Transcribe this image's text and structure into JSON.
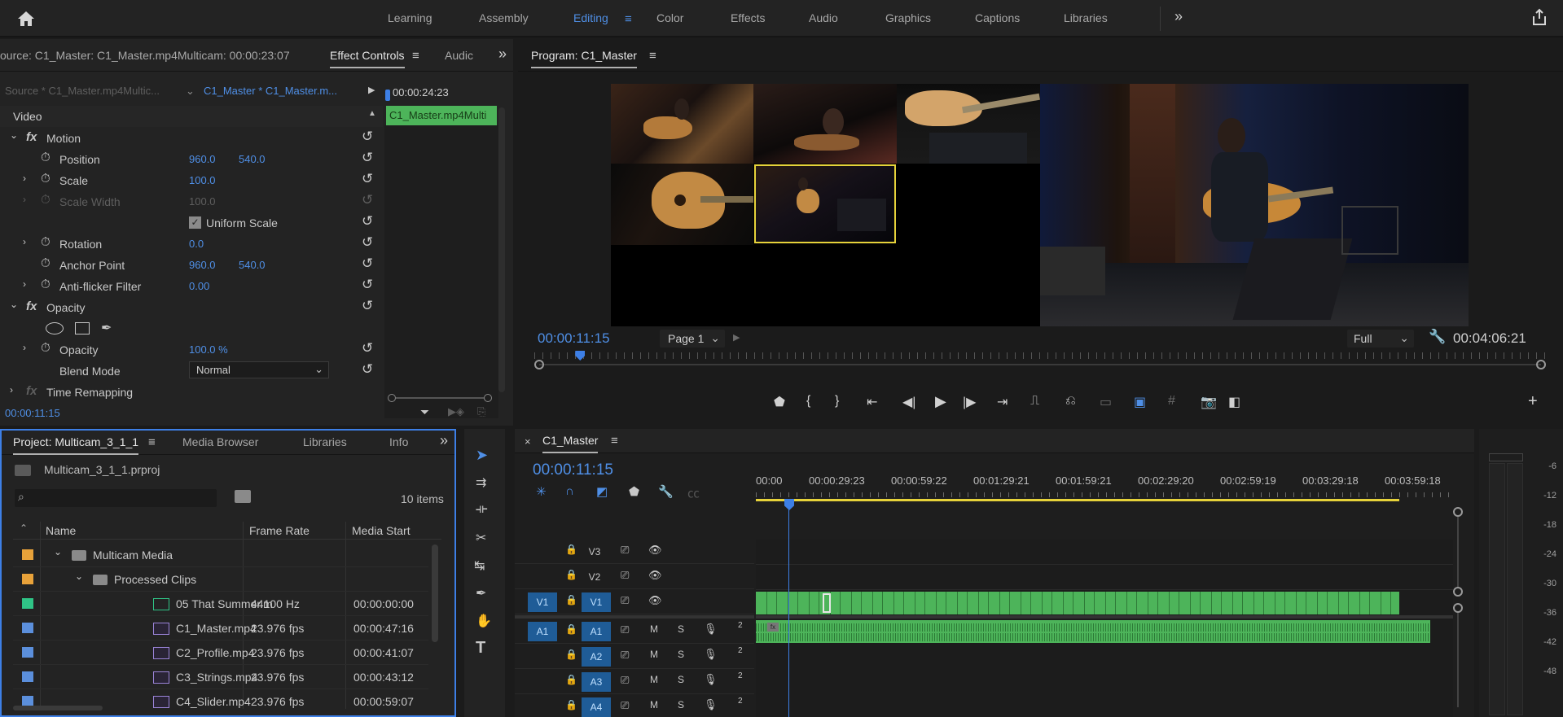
{
  "workspaces": {
    "tabs": [
      {
        "label": "Learning",
        "active": false
      },
      {
        "label": "Assembly",
        "active": false
      },
      {
        "label": "Editing",
        "active": true
      },
      {
        "label": "Color",
        "active": false
      },
      {
        "label": "Effects",
        "active": false
      },
      {
        "label": "Audio",
        "active": false
      },
      {
        "label": "Graphics",
        "active": false
      },
      {
        "label": "Captions",
        "active": false
      },
      {
        "label": "Libraries",
        "active": false
      }
    ],
    "accent": "#4f8fe6"
  },
  "effect_controls": {
    "source_tab": "ource: C1_Master: C1_Master.mp4Multicam: 00:00:23:07",
    "tab_label": "Effect Controls",
    "audio_tab": "Audic",
    "source_dropdown": "Source * C1_Master.mp4Multic...",
    "sequence_dropdown": "C1_Master * C1_Master.m...",
    "mini_timecode": "00:00:24:23",
    "clip_label": "C1_Master.mp4Multi",
    "section_video": "Video",
    "motion": "Motion",
    "position_label": "Position",
    "position_x": "960.0",
    "position_y": "540.0",
    "scale_label": "Scale",
    "scale_value": "100.0",
    "scale_width_label": "Scale Width",
    "scale_width_value": "100.0",
    "uniform_scale_label": "Uniform Scale",
    "rotation_label": "Rotation",
    "rotation_value": "0.0",
    "anchor_label": "Anchor Point",
    "anchor_x": "960.0",
    "anchor_y": "540.0",
    "antiflicker_label": "Anti-flicker Filter",
    "antiflicker_value": "0.00",
    "opacity_section": "Opacity",
    "opacity_label": "Opacity",
    "opacity_value": "100.0 %",
    "blend_label": "Blend Mode",
    "blend_value": "Normal",
    "time_remap_label": "Time Remapping",
    "timecode": "00:00:11:15"
  },
  "program": {
    "title": "Program: C1_Master",
    "timecode": "00:00:11:15",
    "page_dropdown": "Page 1",
    "quality": "Full",
    "duration": "00:04:06:21",
    "playhead_fraction": 0.036
  },
  "project": {
    "tabs": [
      "Project: Multicam_3_1_1",
      "Media Browser",
      "Libraries",
      "Info"
    ],
    "project_file": "Multicam_3_1_1.prproj",
    "items_count": "10 items",
    "search_placeholder": "",
    "columns": [
      "Name",
      "Frame Rate",
      "Media Start"
    ],
    "rows": [
      {
        "name": "Multicam Media",
        "rate": "",
        "start": "",
        "color": "#e8a23a",
        "kind": "bin",
        "indent": 0
      },
      {
        "name": "Processed Clips",
        "rate": "",
        "start": "",
        "color": "#e8a23a",
        "kind": "bin",
        "indent": 1
      },
      {
        "name": "05 That Summer.m",
        "rate": "44100 Hz",
        "start": "00:00:00:00",
        "color": "#2fc486",
        "kind": "audio",
        "indent": 2
      },
      {
        "name": "C1_Master.mp4",
        "rate": "23.976 fps",
        "start": "00:00:47:16",
        "color": "#5b8fdc",
        "kind": "clip",
        "indent": 2
      },
      {
        "name": "C2_Profile.mp4",
        "rate": "23.976 fps",
        "start": "00:00:41:07",
        "color": "#5b8fdc",
        "kind": "clip",
        "indent": 2
      },
      {
        "name": "C3_Strings.mp4",
        "rate": "23.976 fps",
        "start": "00:00:43:12",
        "color": "#5b8fdc",
        "kind": "clip",
        "indent": 2
      },
      {
        "name": "C4_Slider.mp4",
        "rate": "23.976 fps",
        "start": "00:00:59:07",
        "color": "#5b8fdc",
        "kind": "clip",
        "indent": 2
      }
    ]
  },
  "timeline": {
    "tab": "C1_Master",
    "timecode": "00:00:11:15",
    "ruler": [
      "00:00",
      "00:00:29:23",
      "00:00:59:22",
      "00:01:29:21",
      "00:01:59:21",
      "00:02:29:20",
      "00:02:59:19",
      "00:03:29:18",
      "00:03:59:18"
    ],
    "video_tracks": [
      "V3",
      "V2",
      "V1"
    ],
    "audio_tracks": [
      "A1",
      "A2",
      "A3",
      "A4"
    ],
    "source_v": "V1",
    "source_a": "A1",
    "mute": "M",
    "solo": "S",
    "channel": "2",
    "clip_color": "#4db45a"
  },
  "audio_meter": {
    "labels": [
      "-6",
      "-12",
      "-18",
      "-24",
      "-30",
      "-36",
      "-42",
      "-48"
    ]
  }
}
